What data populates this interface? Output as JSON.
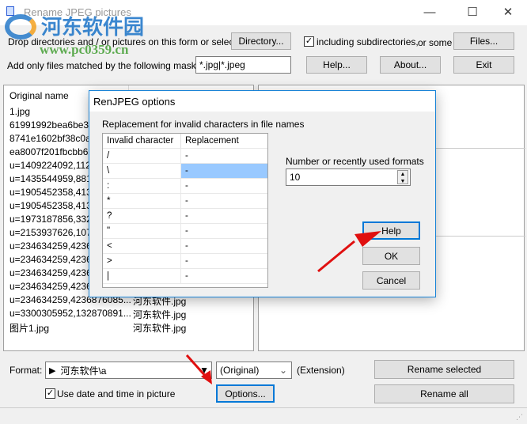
{
  "window": {
    "title": "Rename JPEG pictures",
    "minimize": "—",
    "maximize": "☐",
    "close": "✕"
  },
  "watermark": {
    "brand": "河东软件园",
    "url": "www.pc0359.cn"
  },
  "toolbar": {
    "drop_label": "Drop directories and / or pictures on this form or select a",
    "directory_button": "Directory...",
    "include_subdirs_label": "including subdirectories,",
    "include_subdirs_checked": true,
    "or_some_label": "or some",
    "files_button": "Files...",
    "mask_label": "Add only files matched by the following mask(s) :",
    "mask_value": "*.jpg|*.jpeg",
    "help_button": "Help...",
    "about_button": "About...",
    "exit_button": "Exit"
  },
  "file_list": {
    "header": "Original name",
    "rows": [
      {
        "name": "1.jpg",
        "new": ""
      },
      {
        "name": "61991992bea6be389",
        "new": ""
      },
      {
        "name": "8741e1602bf38c0a22",
        "new": ""
      },
      {
        "name": "ea8007f201fbcbb627",
        "new": ""
      },
      {
        "name": "u=1409224092,1124",
        "new": ""
      },
      {
        "name": "u=1435544959,8810",
        "new": ""
      },
      {
        "name": "u=1905452358,4132",
        "new": ""
      },
      {
        "name": "u=1905452358,4132",
        "new": ""
      },
      {
        "name": "u=1973187856,3326",
        "new": ""
      },
      {
        "name": "u=2153937626,1074",
        "new": ""
      },
      {
        "name": "u=234634259,42368",
        "new": ""
      },
      {
        "name": "u=234634259,42368",
        "new": ""
      },
      {
        "name": "u=234634259,42368",
        "new": ""
      },
      {
        "name": "u=234634259,42368",
        "new": ""
      },
      {
        "name": "u=234634259,4236876085...",
        "new": "河东软件.jpg"
      },
      {
        "name": "u=3300305952,132870891...",
        "new": "河东软件.jpg"
      },
      {
        "name": "图片1.jpg",
        "new": "河东软件.jpg"
      }
    ]
  },
  "bottom": {
    "format_label": "Format:",
    "format_value": "河东软件\\a",
    "extension_value": "(Original)",
    "extension_label": "(Extension)",
    "use_date_label": "Use date and time in picture",
    "use_date_checked": true,
    "options_button": "Options...",
    "rename_selected_button": "Rename selected",
    "rename_all_button": "Rename all"
  },
  "dialog": {
    "title": "RenJPEG options",
    "replacement_label": "Replacement for invalid characters in file names",
    "columns": [
      "Invalid character",
      "Replacement"
    ],
    "rows": [
      {
        "char": "/",
        "rep": "-"
      },
      {
        "char": "\\",
        "rep": "-"
      },
      {
        "char": ":",
        "rep": "-"
      },
      {
        "char": "*",
        "rep": "-"
      },
      {
        "char": "?",
        "rep": "-"
      },
      {
        "char": "\"",
        "rep": "-"
      },
      {
        "char": "<",
        "rep": "-"
      },
      {
        "char": ">",
        "rep": "-"
      },
      {
        "char": "|",
        "rep": "-"
      }
    ],
    "selected_row": 1,
    "recent_label": "Number or recently used formats",
    "recent_value": "10",
    "help_button": "Help",
    "ok_button": "OK",
    "cancel_button": "Cancel"
  },
  "colors": {
    "accent": "#0078d7",
    "selection": "#99c9ff",
    "arrow": "#e01010"
  }
}
